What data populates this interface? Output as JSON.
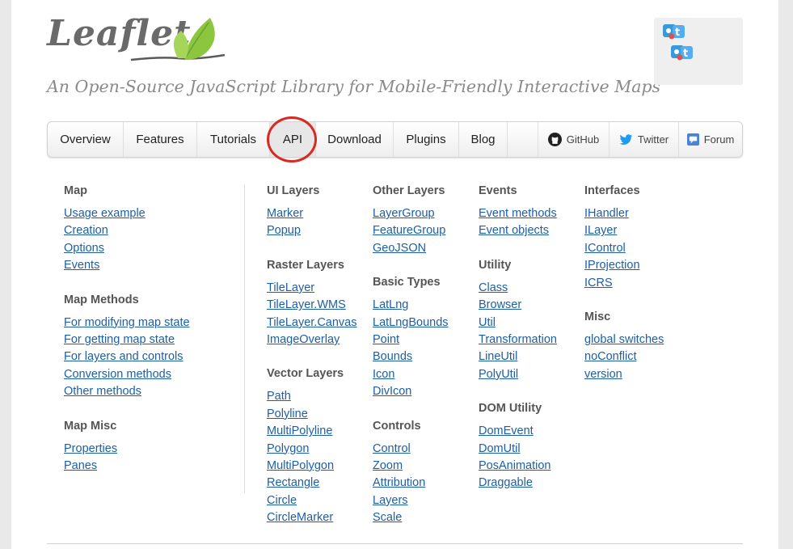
{
  "header": {
    "logo_text": "Leaflet",
    "tagline": "An Open-Source JavaScript Library for Mobile-Friendly Interactive Maps"
  },
  "nav": {
    "items": [
      {
        "label": "Overview"
      },
      {
        "label": "Features"
      },
      {
        "label": "Tutorials"
      },
      {
        "label": "API",
        "active": true
      },
      {
        "label": "Download"
      },
      {
        "label": "Plugins"
      },
      {
        "label": "Blog"
      }
    ],
    "external": [
      {
        "label": "GitHub",
        "icon": "github-icon"
      },
      {
        "label": "Twitter",
        "icon": "twitter-icon"
      },
      {
        "label": "Forum",
        "icon": "forum-icon"
      }
    ]
  },
  "sections": {
    "col1": [
      {
        "title": "Map",
        "links": [
          "Usage example",
          "Creation",
          "Options",
          "Events"
        ]
      },
      {
        "title": "Map Methods",
        "links": [
          "For modifying map state",
          "For getting map state",
          "For layers and controls",
          "Conversion methods",
          "Other methods"
        ]
      },
      {
        "title": "Map Misc",
        "links": [
          "Properties",
          "Panes"
        ]
      }
    ],
    "col2": [
      {
        "title": "UI Layers",
        "links": [
          "Marker",
          "Popup"
        ]
      },
      {
        "title": "Raster Layers",
        "links": [
          "TileLayer",
          "TileLayer.WMS",
          "TileLayer.Canvas",
          "ImageOverlay"
        ]
      },
      {
        "title": "Vector Layers",
        "links": [
          "Path",
          "Polyline",
          "MultiPolyline",
          "Polygon",
          "MultiPolygon",
          "Rectangle",
          "Circle",
          "CircleMarker"
        ]
      }
    ],
    "col3": [
      {
        "title": "Other Layers",
        "links": [
          "LayerGroup",
          "FeatureGroup",
          "GeoJSON"
        ]
      },
      {
        "title": "Basic Types",
        "links": [
          "LatLng",
          "LatLngBounds",
          "Point",
          "Bounds",
          "Icon",
          "DivIcon"
        ]
      },
      {
        "title": "Controls",
        "links": [
          "Control",
          "Zoom",
          "Attribution",
          "Layers",
          "Scale"
        ]
      }
    ],
    "col4": [
      {
        "title": "Events",
        "links": [
          "Event methods",
          "Event objects"
        ]
      },
      {
        "title": "Utility",
        "links": [
          "Class",
          "Browser",
          "Util",
          "Transformation",
          "LineUtil",
          "PolyUtil"
        ]
      },
      {
        "title": "DOM Utility",
        "links": [
          "DomEvent",
          "DomUtil",
          "PosAnimation",
          "Draggable"
        ]
      }
    ],
    "col5": [
      {
        "title": "Interfaces",
        "links": [
          "IHandler",
          "ILayer",
          "IControl",
          "IProjection",
          "ICRS"
        ]
      },
      {
        "title": "Misc",
        "links": [
          "global switches",
          "noConflict",
          "version"
        ]
      }
    ]
  },
  "colors": {
    "link": "#1c5fa8",
    "heading": "#555555",
    "highlight_ring": "#d62a22",
    "leaf": "#8cc63f"
  }
}
